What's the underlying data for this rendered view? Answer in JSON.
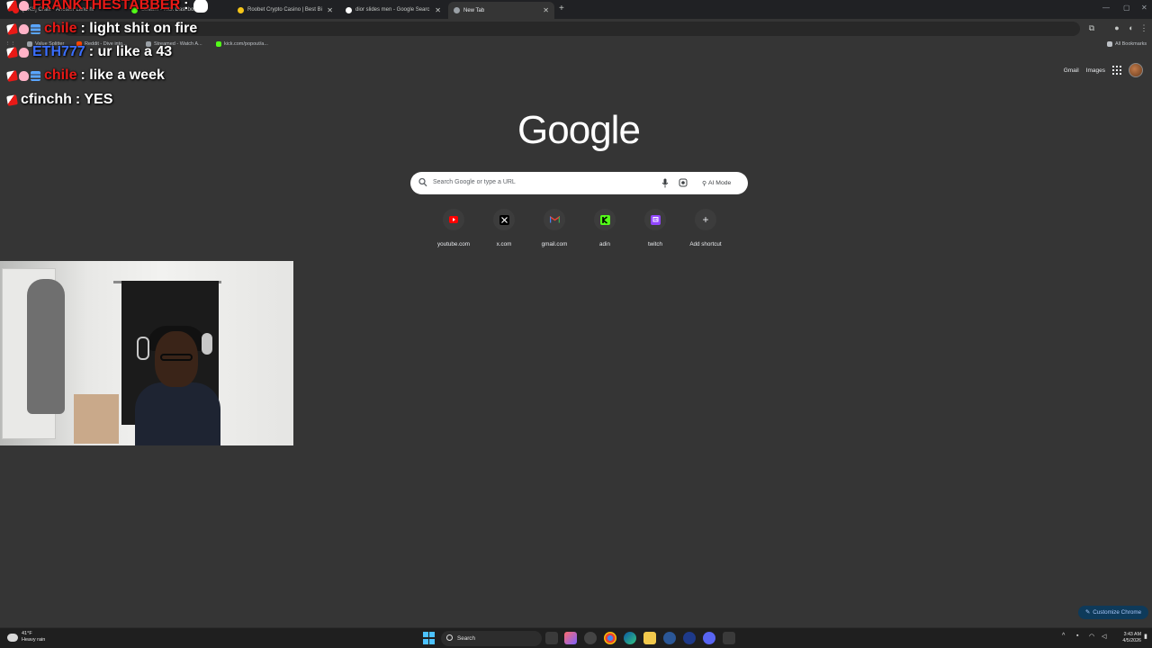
{
  "browser": {
    "tabs": [
      {
        "title": "[UKS] Crate - Anoster Land hi",
        "favicon_color": "#e91916",
        "active": false
      },
      {
        "title": "Stream - Kick Dashboar",
        "favicon_color": "#53fc18",
        "active": false
      },
      {
        "title": "Roobet Crypto Casino | Best Bi",
        "favicon_color": "#f5c518",
        "active": false
      },
      {
        "title": "dior slides men - Google Searc",
        "favicon_color": "#ffffff",
        "active": false
      },
      {
        "title": "New Tab",
        "favicon_color": "#9aa0a6",
        "active": true
      }
    ],
    "new_tab_glyph": "+",
    "bookmarks": [
      {
        "label": "Value Splitter",
        "color": "#9aa0a6"
      },
      {
        "label": "Reddit - Dive into...",
        "color": "#ff4500"
      },
      {
        "label": "Streamed - Watch A...",
        "color": "#9aa0a6"
      },
      {
        "label": "kick.com/popout/a...",
        "color": "#53fc18"
      }
    ],
    "all_bookmarks": "All Bookmarks"
  },
  "google": {
    "logo": "Google",
    "top_links": {
      "gmail": "Gmail",
      "images": "Images"
    },
    "search_placeholder": "Search Google or type a URL",
    "ai_mode": "AI Mode",
    "shortcuts": [
      {
        "label": "youtube.com",
        "icon": "youtube-icon",
        "color": "#ff0000"
      },
      {
        "label": "x.com",
        "icon": "x-icon",
        "color": "#ffffff"
      },
      {
        "label": "gmail.com",
        "icon": "gmail-icon",
        "color": "#ea4335"
      },
      {
        "label": "adin",
        "icon": "kick-icon",
        "color": "#53fc18"
      },
      {
        "label": "twitch",
        "icon": "twitch-icon",
        "color": "#9146ff"
      },
      {
        "label": "Add shortcut",
        "icon": "plus-icon",
        "color": "#e8eaed"
      }
    ],
    "customize": "Customize Chrome"
  },
  "chat": [
    {
      "badges": [
        "pencil",
        "heart"
      ],
      "user": "FRANKTHESTABBER",
      "user_color": "#e91916",
      "message": "",
      "emote": "skull-icon"
    },
    {
      "badges": [
        "pencil",
        "heart",
        "bars"
      ],
      "user": "chile",
      "user_color": "#e91916",
      "message": "light shit on fire"
    },
    {
      "badges": [
        "pencil",
        "heart"
      ],
      "user": "ETH777",
      "user_color": "#3b6fff",
      "message": "ur like a 43"
    },
    {
      "badges": [
        "pencil",
        "heart",
        "bars"
      ],
      "user": "chile",
      "user_color": "#e91916",
      "message": "like a week"
    },
    {
      "badges": [
        "pencil"
      ],
      "user": "cfinchh",
      "user_color": "#ffffff",
      "message": "YES"
    }
  ],
  "taskbar": {
    "weather_temp": "41°F",
    "weather_desc": "Heavy rain",
    "search_label": "Search",
    "time": "3:43 AM",
    "date": "4/5/2026"
  }
}
